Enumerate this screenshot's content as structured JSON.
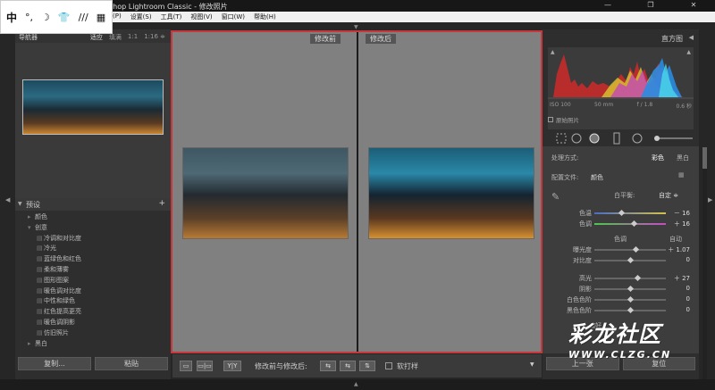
{
  "window": {
    "title": "shop Lightroom Classic - 修改照片",
    "buttons": [
      "—",
      "❐",
      "✕"
    ]
  },
  "ime": {
    "zh": "中",
    "items": [
      "°,",
      "☽",
      "👕",
      "///",
      "▦"
    ]
  },
  "menu": {
    "items": [
      "(P)",
      "设置(S)",
      "工具(T)",
      "视图(V)",
      "窗口(W)",
      "帮助(H)"
    ]
  },
  "navigator": {
    "title": "导航器",
    "zoom": [
      "适应",
      "填满",
      "1:1",
      "1:16 ≑"
    ],
    "zoom_active": 0
  },
  "presets": {
    "title": "预设",
    "plus": "+",
    "rows": [
      {
        "kind": "folder",
        "arrow": "▸",
        "label": "颜色"
      },
      {
        "kind": "folder",
        "arrow": "▾",
        "label": "创意"
      },
      {
        "kind": "item",
        "label": "冷调和对比度"
      },
      {
        "kind": "item",
        "label": "冷光"
      },
      {
        "kind": "item",
        "label": "蓝绿色和红色"
      },
      {
        "kind": "item",
        "label": "柔和薄雾"
      },
      {
        "kind": "item",
        "label": "图形图案"
      },
      {
        "kind": "item",
        "label": "暖色调对比度"
      },
      {
        "kind": "item",
        "label": "中性和绿色"
      },
      {
        "kind": "item",
        "label": "红色提高更亮"
      },
      {
        "kind": "item",
        "label": "暖色调阴影"
      },
      {
        "kind": "item",
        "label": "仿旧照片"
      },
      {
        "kind": "folder",
        "arrow": "▸",
        "label": "黑白"
      }
    ]
  },
  "left_buttons": {
    "copy": "复制...",
    "paste": "粘贴"
  },
  "compare": {
    "before": "修改前",
    "after": "修改后"
  },
  "toolbar": {
    "view_single": "▭",
    "view_compare": "▭|▭",
    "yy": "Y|Y",
    "label": "修改前与修改后:",
    "swap1": "⇆",
    "swap2": "⇆",
    "swap3": "⇅",
    "softproof": "软打样"
  },
  "histogram": {
    "title": "直方图",
    "iso": "ISO 100",
    "focal": "50 mm",
    "aperture": "f / 1.8",
    "shutter": "0.6 秒",
    "original": "原始照片"
  },
  "basic": {
    "treatment_label": "处理方式:",
    "color": "彩色",
    "bw": "黑白",
    "profile_label": "配置文件:",
    "profile": "颜色",
    "wb_label": "白平衡:",
    "wb_value": "自定 ≑",
    "temp_label": "色温",
    "temp_value": "－ 16",
    "tint_label": "色调",
    "tint_value": "＋ 16",
    "tone_label": "色调",
    "auto": "自动",
    "exposure_label": "曝光度",
    "exposure_value": "＋ 1.07",
    "contrast_label": "对比度",
    "contrast_value": "0",
    "highlights_label": "高光",
    "highlights_value": "＋ 27",
    "shadows_label": "阴影",
    "shadows_value": "0",
    "whites_label": "白色色阶",
    "whites_value": "0",
    "blacks_label": "黑色色阶",
    "blacks_value": "0",
    "presence_label": "偏好"
  },
  "right_buttons": {
    "prev": "上一张",
    "reset": "复位"
  },
  "watermark": {
    "text": "彩龙社区",
    "url": "WWW.CLZG.CN"
  },
  "colors": {
    "accent_red": "#c8373c",
    "panel": "#2e2e2e"
  }
}
